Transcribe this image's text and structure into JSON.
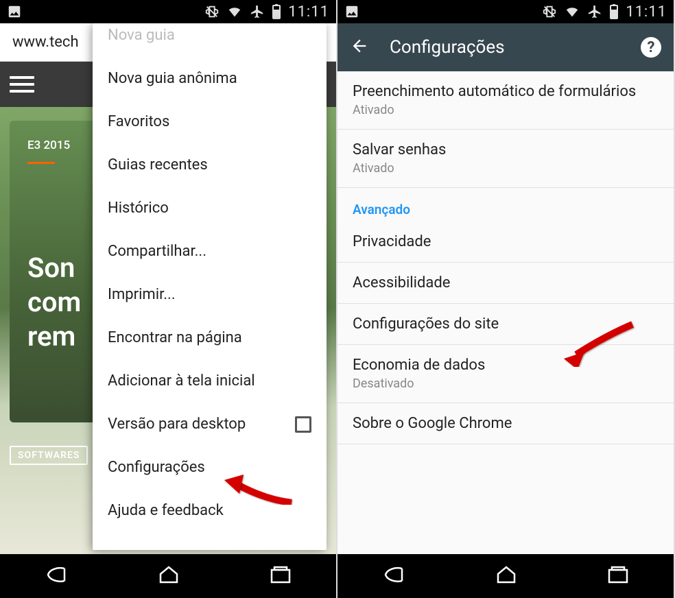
{
  "status": {
    "time": "11:11"
  },
  "left": {
    "url": "www.tech",
    "e3_tag": "E3 2015",
    "article_lines": [
      "Son",
      "com",
      "rem"
    ],
    "softwares_badge": "SOFTWARES",
    "menu": {
      "new_tab_faded": "Nova guia",
      "items": [
        "Nova guia anônima",
        "Favoritos",
        "Guias recentes",
        "Histórico",
        "Compartilhar...",
        "Imprimir...",
        "Encontrar na página",
        "Adicionar à tela inicial",
        "Versão para desktop",
        "Configurações",
        "Ajuda e feedback"
      ]
    }
  },
  "right": {
    "title": "Configurações",
    "autofill": {
      "title": "Preenchimento automático de formulários",
      "sub": "Ativado"
    },
    "passwords": {
      "title": "Salvar senhas",
      "sub": "Ativado"
    },
    "section_advanced": "Avançado",
    "privacy": "Privacidade",
    "accessibility": "Acessibilidade",
    "site_settings": "Configurações do site",
    "data_saver": {
      "title": "Economia de dados",
      "sub": "Desativado"
    },
    "about": "Sobre o Google Chrome"
  }
}
